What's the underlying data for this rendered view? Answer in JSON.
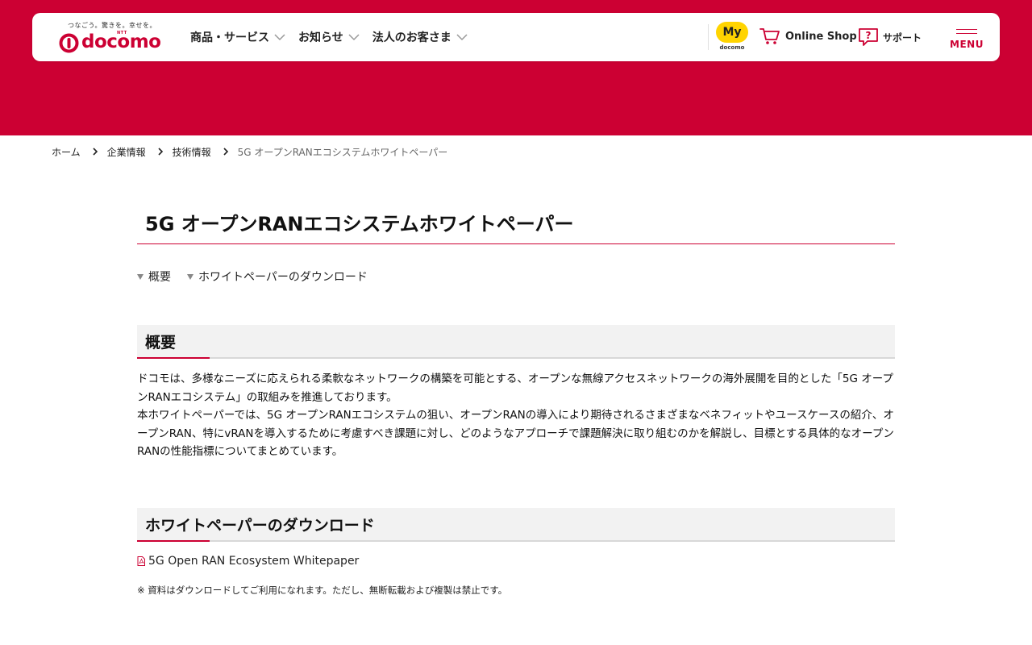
{
  "brand": {
    "tagline": "つなごう。驚きを。幸せを。",
    "ntt": "NTT",
    "name": "docomo",
    "color": "#cc0033"
  },
  "nav": {
    "items": [
      {
        "label": "商品・サービス"
      },
      {
        "label": "お知らせ"
      },
      {
        "label": "法人のお客さま"
      }
    ]
  },
  "utility": {
    "my_badge": "My",
    "my_sub": "docomo",
    "online_shop": "Online Shop",
    "support": "サポート",
    "menu": "MENU",
    "my_badge_color": "#ffd400"
  },
  "breadcrumb": {
    "items": [
      {
        "label": "ホーム"
      },
      {
        "label": "企業情報"
      },
      {
        "label": "技術情報"
      }
    ],
    "current": "5G オープンRANエコシステムホワイトペーパー"
  },
  "page": {
    "title": "5G オープンRANエコシステムホワイトペーパー"
  },
  "anchors": [
    {
      "label": "概要"
    },
    {
      "label": "ホワイトペーパーのダウンロード"
    }
  ],
  "overview": {
    "heading": "概要",
    "paragraphs": [
      "ドコモは、多様なニーズに応えられる柔軟なネットワークの構築を可能とする、オープンな無線アクセスネットワークの海外展開を目的とした「5G オープンRANエコシステム」の取組みを推進しております。",
      "本ホワイトペーパーでは、5G オープンRANエコシステムの狙い、オープンRANの導入により期待されるさまざまなベネフィットやユースケースの紹介、オープンRAN、特にvRANを導入するために考慮すべき課題に対し、どのようなアプローチで課題解決に取り組むのかを解説し、目標とする具体的なオープンRANの性能指標についてまとめています。"
    ]
  },
  "download": {
    "heading": "ホワイトペーパーのダウンロード",
    "link_label": "5G Open RAN Ecosystem Whitepaper",
    "note": "※ 資料はダウンロードしてご利用になれます。ただし、無断転載および複製は禁止です。"
  }
}
